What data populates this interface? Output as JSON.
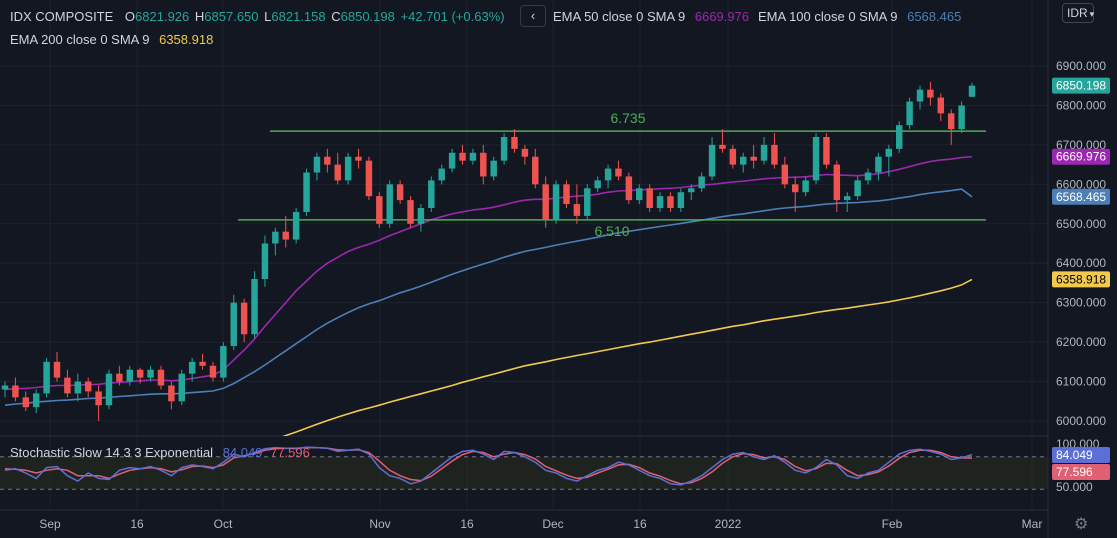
{
  "header": {
    "symbol": "IDX COMPOSITE",
    "o_label": "O",
    "o_value": "6821.926",
    "h_label": "H",
    "h_value": "6857.650",
    "l_label": "L",
    "l_value": "6821.158",
    "c_label": "C",
    "c_value": "6850.198",
    "change": "+42.701 (+0.63%)",
    "collapse_icon": "chevron-left-icon",
    "currency": "IDR",
    "settings_icon": "gear-icon"
  },
  "indicators": [
    {
      "label": "EMA 50 close 0 SMA 9",
      "value": "6669.976",
      "color": "#9c27b0"
    },
    {
      "label": "EMA 100 close 0 SMA 9",
      "value": "6568.465",
      "color": "#4c7fb7"
    },
    {
      "label": "EMA 200 close 0 SMA 9",
      "value": "6358.918",
      "color": "#f2c94c"
    }
  ],
  "stoch": {
    "label": "Stochastic Slow 14 3 3 Exponential",
    "k_value": "84.049",
    "d_value": "77.596",
    "k_color": "#5b6fd6",
    "d_color": "#e05f73",
    "axis_label": "100.000",
    "axis_label2": "50.000"
  },
  "chart_data": {
    "type": "candlestick",
    "up_color": "#26a69a",
    "down_color": "#ef5350",
    "y_ticks": [
      "6900.000",
      "6800.000",
      "6700.000",
      "6600.000",
      "6500.000",
      "6400.000",
      "6300.000",
      "6200.000",
      "6100.000",
      "6000.000"
    ],
    "ylim": [
      5970,
      6930
    ],
    "x_labels": [
      "Sep",
      "16",
      "Oct",
      "Nov",
      "16",
      "Dec",
      "16",
      "2022",
      "Feb",
      "Mar"
    ],
    "last_price_label": "6850.198",
    "levels": [
      {
        "label": "6.735",
        "value": 6735
      },
      {
        "label": "6.510",
        "value": 6510
      }
    ],
    "candles": [
      [
        6080,
        6100,
        6060,
        6090
      ],
      [
        6090,
        6110,
        6050,
        6060
      ],
      [
        6060,
        6075,
        6025,
        6035
      ],
      [
        6035,
        6080,
        6020,
        6070
      ],
      [
        6070,
        6160,
        6060,
        6150
      ],
      [
        6150,
        6175,
        6100,
        6110
      ],
      [
        6110,
        6130,
        6060,
        6070
      ],
      [
        6070,
        6120,
        6050,
        6100
      ],
      [
        6100,
        6110,
        6060,
        6075
      ],
      [
        6075,
        6090,
        6000,
        6040
      ],
      [
        6040,
        6130,
        6030,
        6120
      ],
      [
        6120,
        6140,
        6090,
        6100
      ],
      [
        6100,
        6140,
        6090,
        6130
      ],
      [
        6130,
        6135,
        6095,
        6110
      ],
      [
        6110,
        6140,
        6100,
        6130
      ],
      [
        6130,
        6140,
        6080,
        6090
      ],
      [
        6090,
        6100,
        6030,
        6050
      ],
      [
        6050,
        6130,
        6040,
        6120
      ],
      [
        6120,
        6160,
        6100,
        6150
      ],
      [
        6150,
        6170,
        6130,
        6140
      ],
      [
        6140,
        6150,
        6100,
        6110
      ],
      [
        6110,
        6200,
        6100,
        6190
      ],
      [
        6190,
        6320,
        6180,
        6300
      ],
      [
        6300,
        6310,
        6200,
        6220
      ],
      [
        6220,
        6380,
        6210,
        6360
      ],
      [
        6360,
        6470,
        6340,
        6450
      ],
      [
        6450,
        6490,
        6420,
        6480
      ],
      [
        6480,
        6520,
        6440,
        6460
      ],
      [
        6460,
        6540,
        6450,
        6530
      ],
      [
        6530,
        6640,
        6520,
        6630
      ],
      [
        6630,
        6680,
        6610,
        6670
      ],
      [
        6670,
        6690,
        6630,
        6650
      ],
      [
        6650,
        6680,
        6600,
        6610
      ],
      [
        6610,
        6680,
        6600,
        6670
      ],
      [
        6670,
        6690,
        6640,
        6660
      ],
      [
        6660,
        6670,
        6560,
        6570
      ],
      [
        6570,
        6580,
        6490,
        6500
      ],
      [
        6500,
        6610,
        6490,
        6600
      ],
      [
        6600,
        6610,
        6550,
        6560
      ],
      [
        6560,
        6570,
        6490,
        6500
      ],
      [
        6500,
        6550,
        6480,
        6540
      ],
      [
        6540,
        6620,
        6530,
        6610
      ],
      [
        6610,
        6650,
        6600,
        6640
      ],
      [
        6640,
        6690,
        6630,
        6680
      ],
      [
        6680,
        6700,
        6650,
        6660
      ],
      [
        6660,
        6690,
        6650,
        6680
      ],
      [
        6680,
        6700,
        6600,
        6620
      ],
      [
        6620,
        6670,
        6610,
        6660
      ],
      [
        6660,
        6730,
        6650,
        6720
      ],
      [
        6720,
        6740,
        6680,
        6690
      ],
      [
        6690,
        6700,
        6650,
        6670
      ],
      [
        6670,
        6690,
        6590,
        6600
      ],
      [
        6600,
        6620,
        6490,
        6510
      ],
      [
        6510,
        6610,
        6500,
        6600
      ],
      [
        6600,
        6610,
        6540,
        6550
      ],
      [
        6550,
        6600,
        6500,
        6520
      ],
      [
        6520,
        6600,
        6510,
        6590
      ],
      [
        6590,
        6620,
        6580,
        6610
      ],
      [
        6610,
        6650,
        6590,
        6640
      ],
      [
        6640,
        6660,
        6610,
        6620
      ],
      [
        6620,
        6630,
        6550,
        6560
      ],
      [
        6560,
        6600,
        6550,
        6590
      ],
      [
        6590,
        6600,
        6530,
        6540
      ],
      [
        6540,
        6580,
        6530,
        6570
      ],
      [
        6570,
        6580,
        6530,
        6540
      ],
      [
        6540,
        6590,
        6530,
        6580
      ],
      [
        6580,
        6600,
        6560,
        6590
      ],
      [
        6590,
        6630,
        6580,
        6620
      ],
      [
        6620,
        6720,
        6610,
        6700
      ],
      [
        6700,
        6740,
        6680,
        6690
      ],
      [
        6690,
        6700,
        6640,
        6650
      ],
      [
        6650,
        6680,
        6630,
        6670
      ],
      [
        6670,
        6700,
        6640,
        6660
      ],
      [
        6660,
        6720,
        6650,
        6700
      ],
      [
        6700,
        6730,
        6640,
        6650
      ],
      [
        6650,
        6670,
        6590,
        6600
      ],
      [
        6600,
        6620,
        6530,
        6580
      ],
      [
        6580,
        6620,
        6570,
        6610
      ],
      [
        6610,
        6730,
        6600,
        6720
      ],
      [
        6720,
        6730,
        6640,
        6650
      ],
      [
        6650,
        6660,
        6530,
        6560
      ],
      [
        6560,
        6580,
        6530,
        6570
      ],
      [
        6570,
        6620,
        6560,
        6610
      ],
      [
        6610,
        6640,
        6600,
        6630
      ],
      [
        6630,
        6680,
        6610,
        6670
      ],
      [
        6670,
        6700,
        6620,
        6690
      ],
      [
        6690,
        6760,
        6680,
        6750
      ],
      [
        6750,
        6820,
        6740,
        6810
      ],
      [
        6810,
        6850,
        6790,
        6840
      ],
      [
        6840,
        6860,
        6800,
        6820
      ],
      [
        6820,
        6830,
        6760,
        6780
      ],
      [
        6780,
        6790,
        6700,
        6740
      ],
      [
        6740,
        6810,
        6730,
        6800
      ],
      [
        6821.926,
        6857.65,
        6821.158,
        6850.198
      ]
    ],
    "ema50": [
      6080,
      6082,
      6083,
      6085,
      6088,
      6090,
      6090,
      6091,
      6092,
      6093,
      6096,
      6098,
      6100,
      6102,
      6104,
      6104,
      6102,
      6104,
      6108,
      6112,
      6116,
      6130,
      6155,
      6180,
      6208,
      6240,
      6270,
      6300,
      6330,
      6355,
      6380,
      6400,
      6415,
      6430,
      6440,
      6448,
      6458,
      6470,
      6480,
      6490,
      6500,
      6510,
      6518,
      6525,
      6530,
      6535,
      6538,
      6542,
      6548,
      6555,
      6560,
      6562,
      6562,
      6565,
      6568,
      6570,
      6572,
      6575,
      6580,
      6583,
      6584,
      6586,
      6587,
      6589,
      6590,
      6592,
      6595,
      6598,
      6600,
      6603,
      6606,
      6608,
      6611,
      6614,
      6616,
      6617,
      6618,
      6619,
      6622,
      6625,
      6624,
      6623,
      6622,
      6624,
      6627,
      6632,
      6638,
      6645,
      6652,
      6658,
      6662,
      6664,
      6668,
      6669.976
    ],
    "ema100": [
      6040,
      6043,
      6045,
      6048,
      6050,
      6052,
      6053,
      6055,
      6057,
      6058,
      6060,
      6062,
      6064,
      6066,
      6068,
      6069,
      6069,
      6070,
      6072,
      6074,
      6076,
      6083,
      6095,
      6110,
      6125,
      6142,
      6160,
      6178,
      6196,
      6214,
      6232,
      6248,
      6262,
      6275,
      6287,
      6297,
      6305,
      6315,
      6325,
      6333,
      6342,
      6352,
      6362,
      6372,
      6381,
      6390,
      6398,
      6406,
      6415,
      6423,
      6430,
      6435,
      6440,
      6446,
      6451,
      6456,
      6461,
      6466,
      6472,
      6477,
      6481,
      6485,
      6489,
      6493,
      6497,
      6501,
      6505,
      6509,
      6514,
      6518,
      6522,
      6525,
      6529,
      6533,
      6537,
      6540,
      6542,
      6544,
      6547,
      6550,
      6552,
      6553,
      6554,
      6556,
      6558,
      6561,
      6565,
      6569,
      6574,
      6578,
      6581,
      6584,
      6588,
      6568.465
    ],
    "ema200": [
      5870,
      5872,
      5874,
      5876,
      5878,
      5880,
      5882,
      5884,
      5886,
      5888,
      5890,
      5892,
      5894,
      5896,
      5898,
      5900,
      5902,
      5904,
      5906,
      5908,
      5910,
      5914,
      5920,
      5928,
      5936,
      5945,
      5954,
      5963,
      5972,
      5982,
      5992,
      6001,
      6010,
      6018,
      6026,
      6033,
      6040,
      6048,
      6055,
      6062,
      6069,
      6076,
      6083,
      6090,
      6098,
      6105,
      6112,
      6119,
      6126,
      6133,
      6140,
      6145,
      6150,
      6156,
      6161,
      6166,
      6171,
      6176,
      6181,
      6186,
      6191,
      6196,
      6200,
      6205,
      6210,
      6215,
      6220,
      6225,
      6230,
      6235,
      6240,
      6244,
      6249,
      6254,
      6258,
      6262,
      6266,
      6270,
      6275,
      6279,
      6283,
      6286,
      6290,
      6294,
      6298,
      6302,
      6307,
      6312,
      6318,
      6324,
      6330,
      6337,
      6345,
      6358.918
    ],
    "stoch_k": [
      55,
      58,
      50,
      40,
      60,
      62,
      45,
      35,
      50,
      40,
      38,
      55,
      60,
      58,
      62,
      55,
      45,
      60,
      65,
      62,
      58,
      70,
      85,
      80,
      88,
      95,
      97,
      96,
      95,
      98,
      97,
      96,
      90,
      92,
      94,
      85,
      60,
      45,
      40,
      30,
      35,
      50,
      65,
      80,
      90,
      92,
      85,
      75,
      90,
      88,
      80,
      70,
      55,
      50,
      40,
      35,
      45,
      55,
      60,
      70,
      65,
      55,
      45,
      40,
      30,
      28,
      35,
      45,
      60,
      75,
      85,
      88,
      80,
      75,
      82,
      70,
      55,
      50,
      60,
      75,
      65,
      45,
      40,
      50,
      55,
      70,
      85,
      92,
      94,
      90,
      85,
      75,
      78,
      84.049
    ],
    "stoch_d": [
      58,
      57,
      55,
      50,
      55,
      58,
      55,
      45,
      45,
      45,
      40,
      48,
      55,
      58,
      60,
      58,
      52,
      56,
      62,
      63,
      60,
      65,
      78,
      82,
      86,
      92,
      95,
      96,
      96,
      97,
      97,
      96,
      93,
      92,
      93,
      88,
      72,
      55,
      45,
      38,
      36,
      44,
      58,
      72,
      84,
      90,
      88,
      80,
      85,
      88,
      84,
      76,
      62,
      54,
      46,
      40,
      42,
      50,
      57,
      65,
      66,
      60,
      50,
      44,
      36,
      30,
      32,
      40,
      52,
      68,
      80,
      86,
      84,
      78,
      80,
      75,
      62,
      54,
      58,
      68,
      67,
      55,
      45,
      47,
      52,
      63,
      77,
      88,
      92,
      92,
      88,
      80,
      78,
      77.596
    ]
  },
  "time_axis": {
    "settings_icon": "gear-icon"
  }
}
